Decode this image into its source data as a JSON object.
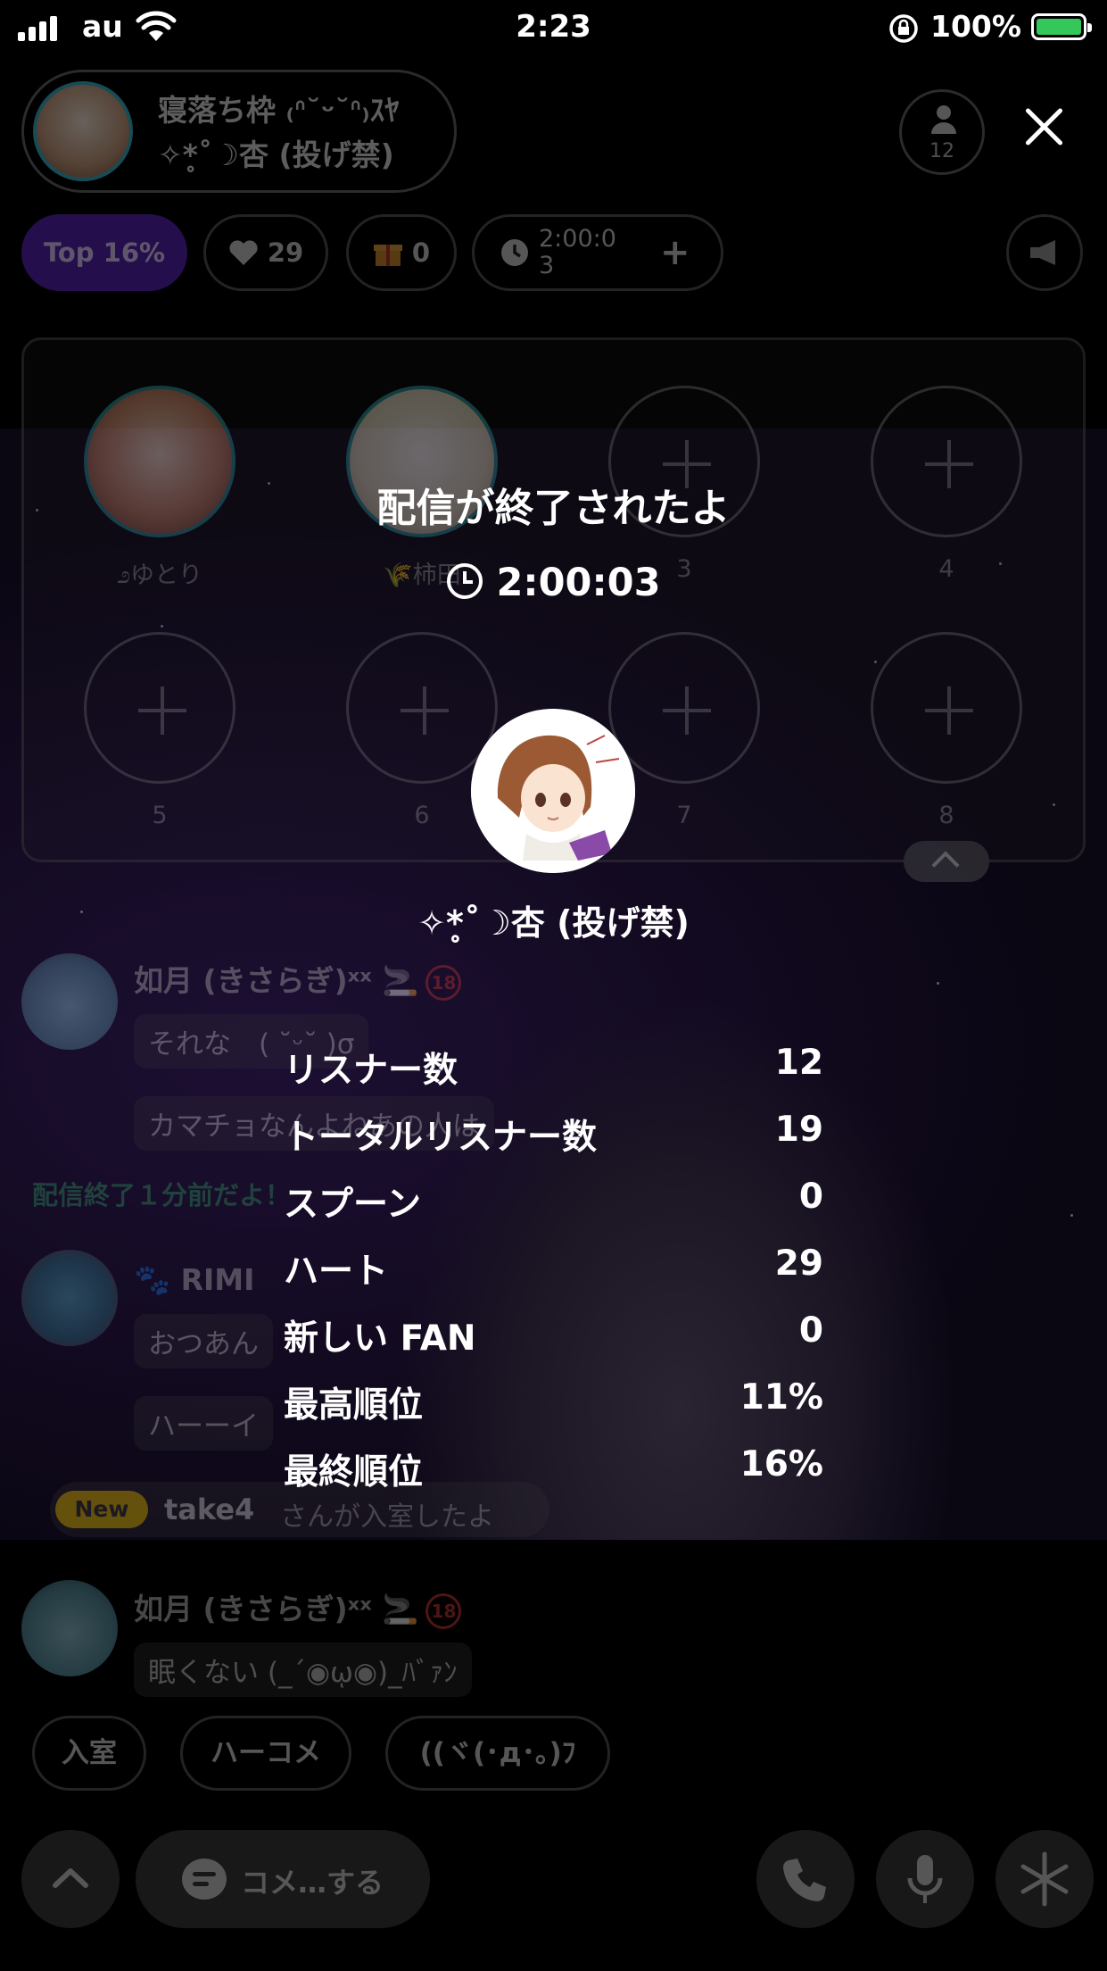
{
  "status_bar": {
    "carrier": "au",
    "time": "2:23",
    "battery": "100%"
  },
  "header": {
    "room_title": "寝落ち枠 ₍ᐢ˘ᵕ˘ᐢ₎ｽﾔ",
    "host_name": "✧*̥˚☽杏 (投げ禁)",
    "listener_count": "12",
    "top_label": "Top 16%",
    "hearts": "29",
    "gifts": "0",
    "timer": "2:00:0\n3"
  },
  "seats": [
    {
      "label": "೨ゆとり",
      "filled": true
    },
    {
      "label": "🌾柿田",
      "filled": true
    },
    {
      "label": "3",
      "filled": false
    },
    {
      "label": "4",
      "filled": false
    },
    {
      "label": "5",
      "filled": false
    },
    {
      "label": "6",
      "filled": false
    },
    {
      "label": "7",
      "filled": false
    },
    {
      "label": "8",
      "filled": false
    }
  ],
  "chat": {
    "msg1_user": "如月 (きさらぎ)ˣˣ 🚬",
    "msg1_text1": "それな　( ˘ᵕ˘ )σ",
    "msg1_text2": "カマチョなんよねあの人は",
    "system_note": "配信終了１分前だよ！",
    "msg2_user": "🐾 RIMI",
    "msg2_text1": "おつあん",
    "msg2_text2": "ハーーイ",
    "new_badge": "New",
    "join_user": "take4",
    "join_text": "さんが入室したよ",
    "msg3_user": "如月 (きさらぎ)ˣˣ 🚬",
    "msg3_text": "眠くない (_´◉ῳ◉)_ﾊﾞｧﾝ",
    "badge": "18"
  },
  "quick_actions": [
    "入室",
    "ハーコメ",
    "((ヾ(･д･｡)ﾌ"
  ],
  "bottom_bar": {
    "comment_label": "コメ…する"
  },
  "modal": {
    "title": "配信が終了されたよ",
    "duration": "2:00:03",
    "dj_name": "✧*̥˚☽杏 (投げ禁)",
    "stats": [
      {
        "label": "リスナー数",
        "value": "12"
      },
      {
        "label": "トータルリスナー数",
        "value": "19"
      },
      {
        "label": "スプーン",
        "value": "0"
      },
      {
        "label": "ハート",
        "value": "29"
      },
      {
        "label": "新しい FAN",
        "value": "0"
      },
      {
        "label": "最高順位",
        "value": "11%"
      },
      {
        "label": "最終順位",
        "value": "16%"
      }
    ]
  },
  "colors": {
    "top_chip": "#5a22b5",
    "seat_ring": "#2f8f96",
    "system_note": "#2e8c5a",
    "new_badge": "#e0b700",
    "battery": "#34c759"
  }
}
